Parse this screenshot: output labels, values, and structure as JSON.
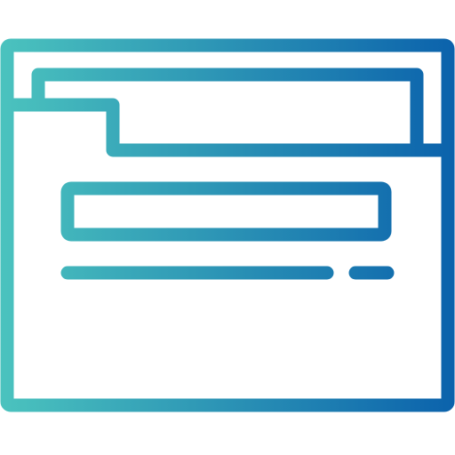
{
  "icon": {
    "name": "browser-window-icon",
    "gradient_start": "#4bc3be",
    "gradient_end": "#0b62ac"
  }
}
